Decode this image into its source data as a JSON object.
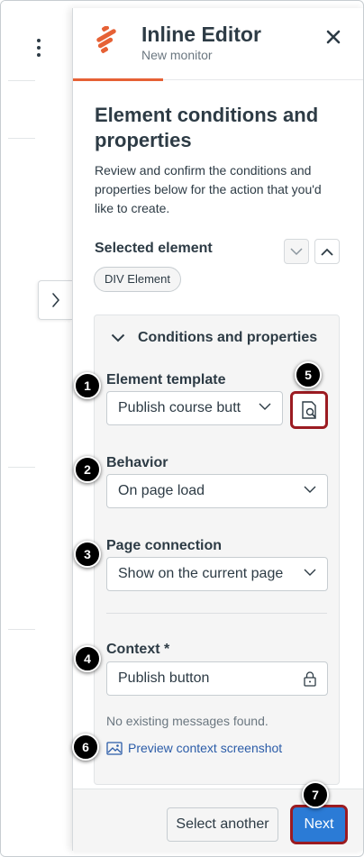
{
  "header": {
    "title": "Inline Editor",
    "subtitle": "New monitor"
  },
  "section": {
    "title": "Element conditions and properties",
    "description": "Review and confirm the conditions and properties below for the action that you'd like to create."
  },
  "selected_element": {
    "label": "Selected element",
    "pill": "DIV Element"
  },
  "conditions": {
    "header": "Conditions and properties",
    "element_template": {
      "label": "Element template",
      "value": "Publish course button"
    },
    "behavior": {
      "label": "Behavior",
      "value": "On page load"
    },
    "page_connection": {
      "label": "Page connection",
      "value": "Show on the current page"
    },
    "context": {
      "label": "Context *",
      "value": "Publish button"
    },
    "no_messages": "No existing messages found.",
    "preview_link": "Preview context screenshot"
  },
  "footer": {
    "secondary": "Select another",
    "primary": "Next"
  },
  "badges": [
    "1",
    "2",
    "3",
    "4",
    "5",
    "6",
    "7"
  ],
  "colors": {
    "accent": "#e66135",
    "primary": "#2b7bd6",
    "highlight": "#9b1b21",
    "link": "#2b5ca8"
  }
}
